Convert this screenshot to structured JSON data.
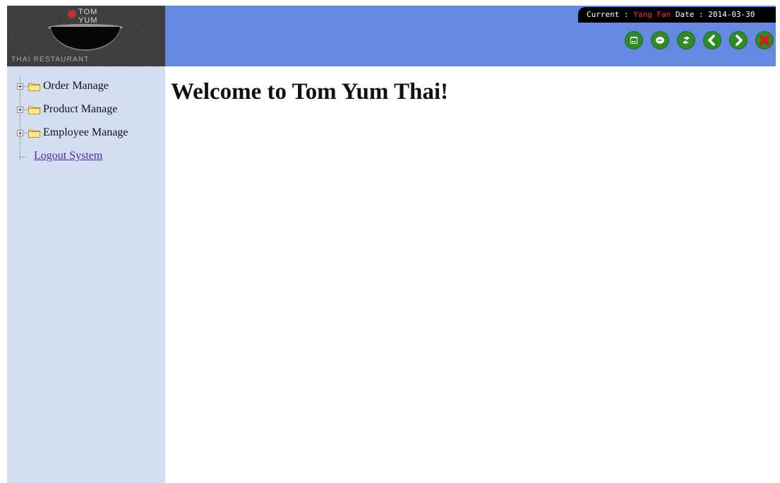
{
  "logo": {
    "line1": "TOM",
    "line2": "YUM",
    "tagline": "THAI RESTAURANT"
  },
  "status": {
    "current_label": "Current : ",
    "user": "Yang Fan",
    "date_label": " Date : ",
    "date": "2014-03-30"
  },
  "toolbar": {
    "buttons": [
      {
        "icon": "window-icon"
      },
      {
        "icon": "chat-icon"
      },
      {
        "icon": "refresh-icon"
      },
      {
        "icon": "back-arrow-icon"
      },
      {
        "icon": "forward-arrow-icon"
      },
      {
        "icon": "close-icon"
      }
    ]
  },
  "sidebar": {
    "items": [
      {
        "label": "Order Manage"
      },
      {
        "label": "Product Manage"
      },
      {
        "label": "Employee Manage"
      }
    ],
    "logout": "Logout System"
  },
  "main": {
    "heading": "Welcome to Tom Yum Thai!"
  },
  "colors": {
    "topbar": "#6589e0",
    "sidebar": "#d3dff0",
    "toolbar_button": "#2e8b25",
    "status_user": "#ff2a2a"
  }
}
